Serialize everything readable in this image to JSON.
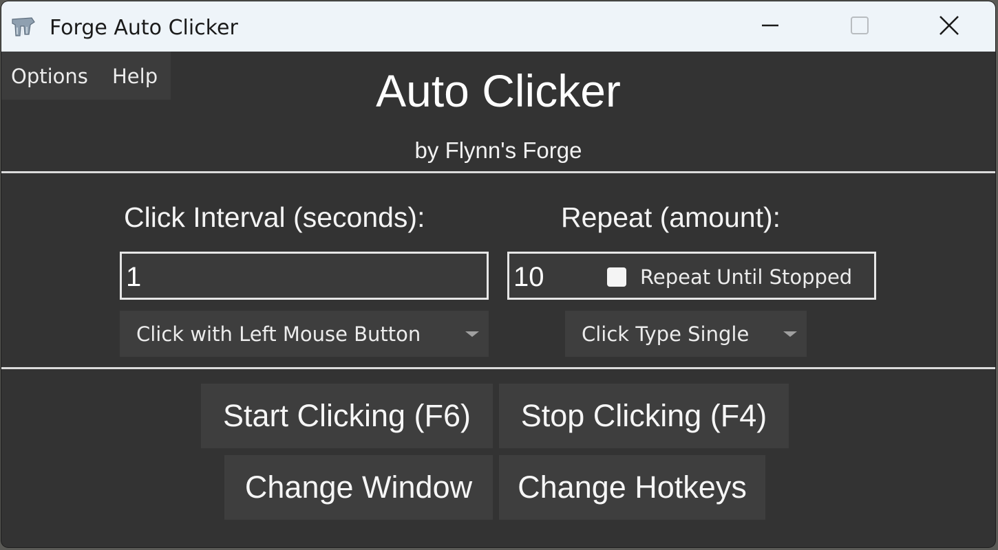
{
  "window": {
    "title": "Forge Auto Clicker",
    "icon": "forge-app-icon",
    "controls": [
      "minimize-icon",
      "maximize-icon",
      "close-icon"
    ]
  },
  "menu": {
    "options_label": "Options",
    "help_label": "Help"
  },
  "header": {
    "title": "Auto Clicker",
    "subtitle": "by Flynn's Forge"
  },
  "interval": {
    "label": "Click Interval (seconds):",
    "value": "1"
  },
  "repeat": {
    "label": "Repeat (amount):",
    "value": "10",
    "until_stopped_label": "Repeat Until Stopped",
    "until_stopped_checked": false
  },
  "mouse_button": {
    "selected": "Click with Left Mouse Button"
  },
  "click_type": {
    "selected": "Click Type Single"
  },
  "actions": {
    "start_label": "Start Clicking (F6)",
    "stop_label": "Stop Clicking (F4)",
    "change_window_label": "Change Window",
    "change_hotkeys_label": "Change Hotkeys"
  },
  "colors": {
    "background": "#333333",
    "titlebar": "#eef4f9",
    "button": "#3e3e3e",
    "text": "#ffffff",
    "divider": "#dcdcdc"
  }
}
